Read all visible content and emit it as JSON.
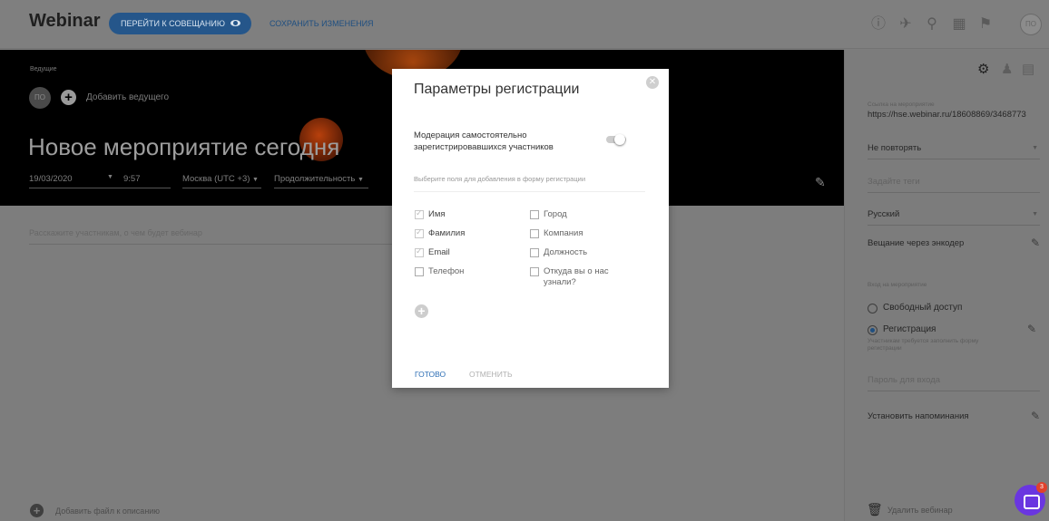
{
  "topbar": {
    "brand": "Webinar",
    "go_button": "ПЕРЕЙТИ К СОВЕЩАНИЮ",
    "save_link": "СОХРАНИТЬ ИЗМЕНЕНИЯ",
    "avatar": "ПО",
    "icons": [
      "alert-icon",
      "rocket-icon",
      "search-icon",
      "apps-grid-icon",
      "flag-icon"
    ]
  },
  "hero": {
    "hosts_label": "Ведущие",
    "host_avatar": "ПО",
    "add_host": "Добавить ведущего",
    "title": "Новое мероприятие сегодня",
    "date": "19/03/2020",
    "time": "9:57",
    "timezone": "Москва (UTC +3)",
    "duration": "Продолжительность"
  },
  "main": {
    "description_placeholder": "Расскажите участникам, о чем будет вебинар",
    "add_file": "Добавить файл к описанию"
  },
  "right_panel": {
    "link_label": "Ссылка на мероприятие",
    "link": "https://hse.webinar.ru/18608869/3468773",
    "repeat": "Не повторять",
    "tags_placeholder": "Задайте теги",
    "language": "Русский",
    "encoder": "Вещание через энкодер",
    "access_label": "Вход на мероприятие",
    "access_free": "Свободный доступ",
    "access_reg": "Регистрация",
    "access_reg_hint": "Участникам требуется заполнить форму регистрации",
    "password_placeholder": "Пароль для входа",
    "reminders": "Установить напоминания",
    "delete": "Удалить вебинар"
  },
  "chat": {
    "badge": "3"
  },
  "modal": {
    "title": "Параметры регистрации",
    "moderation": "Модерация самостоятельно зарегистрировавшихся участников",
    "hint": "Выберите поля для добавления в форму регистрации",
    "fields_left": [
      {
        "label": "Имя",
        "checked": true
      },
      {
        "label": "Фамилия",
        "checked": true
      },
      {
        "label": "Email",
        "checked": true
      },
      {
        "label": "Телефон",
        "checked": false
      }
    ],
    "fields_right": [
      {
        "label": "Город",
        "checked": false
      },
      {
        "label": "Компания",
        "checked": false
      },
      {
        "label": "Должность",
        "checked": false
      },
      {
        "label": "Откуда вы о нас узнали?",
        "checked": false
      }
    ],
    "ok": "ГОТОВО",
    "cancel": "ОТМЕНИТЬ"
  }
}
